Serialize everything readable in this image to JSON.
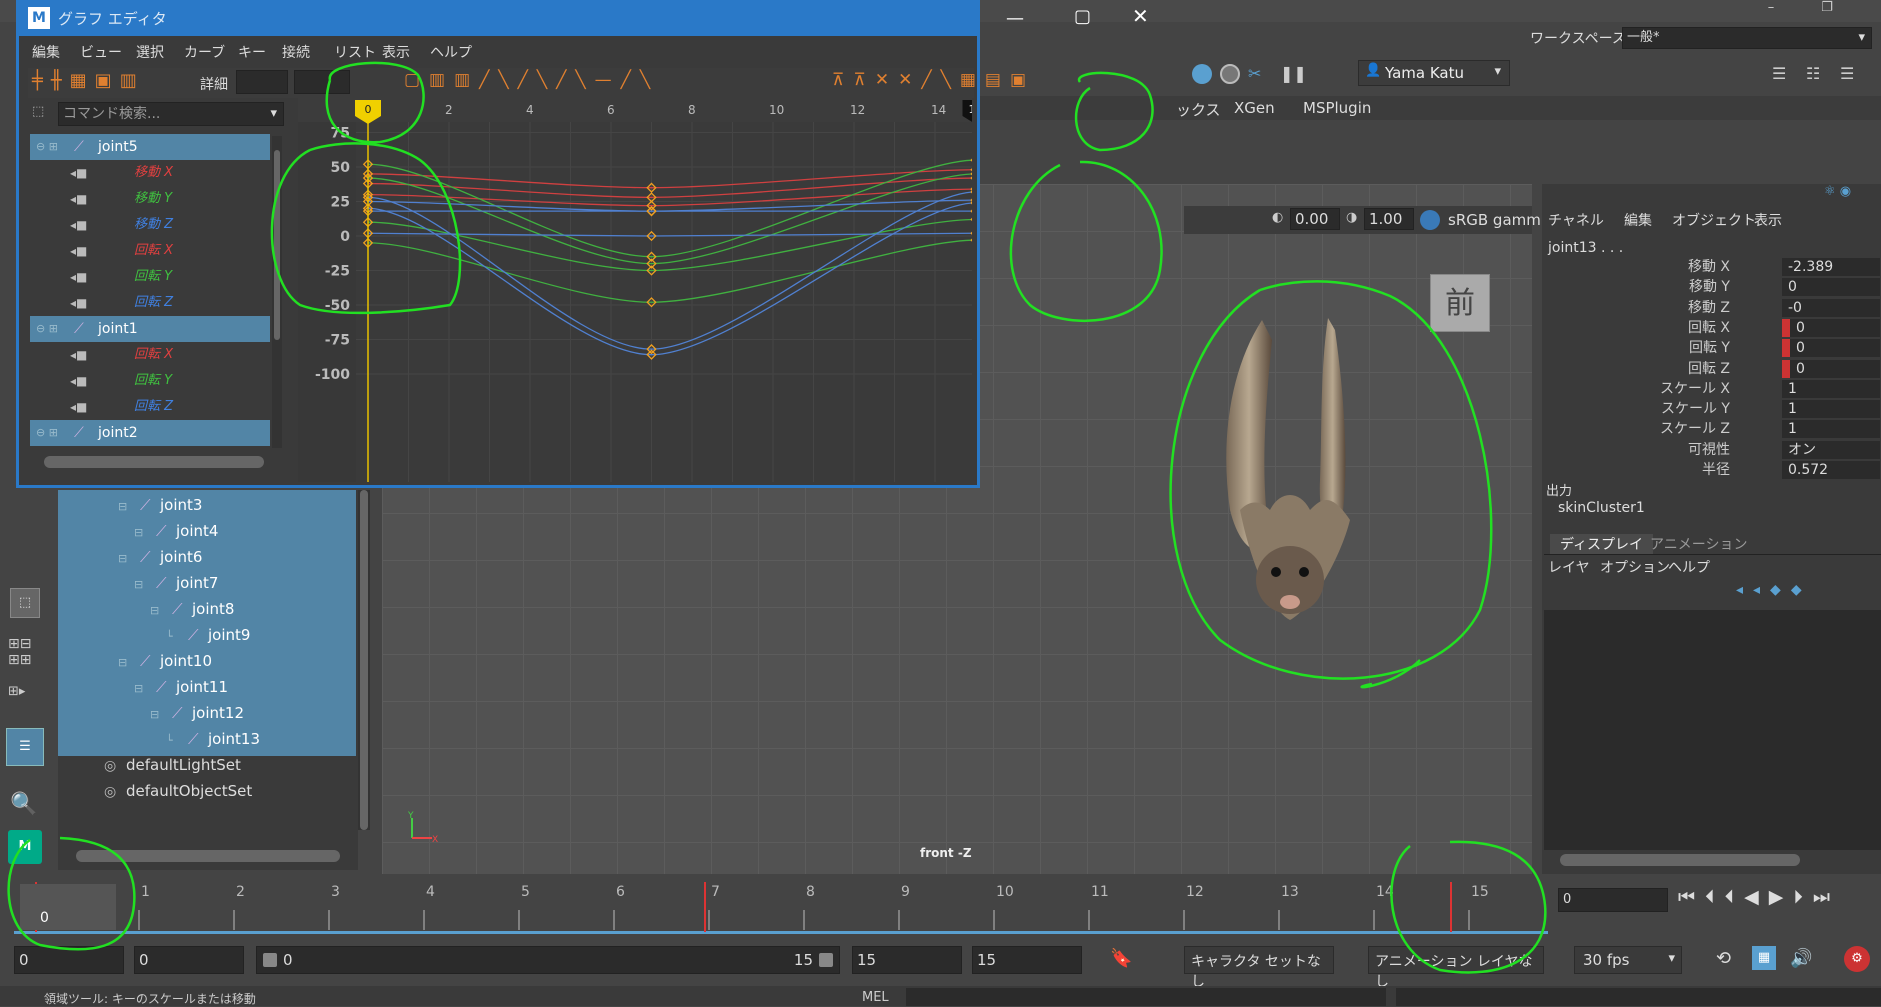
{
  "top_bar": {
    "workspace_label": "ワークスペース:",
    "workspace_value": "一般*",
    "user_name": "Yama Katu"
  },
  "shelf_tabs": [
    "ックス",
    "XGen",
    "MSPlugin"
  ],
  "graph_editor": {
    "title": "グラフ エディタ",
    "menu": [
      "編集",
      "ビュー",
      "選択",
      "カーブ",
      "キー",
      "接続",
      "リスト",
      "表示",
      "ヘルプ"
    ],
    "detail_label": "詳細",
    "search_placeholder": "コマンド検索...",
    "outliner": [
      {
        "type": "joint",
        "label": "joint5"
      },
      {
        "type": "attr",
        "label": "移動 X",
        "color": "#e04040"
      },
      {
        "type": "attr",
        "label": "移動 Y",
        "color": "#40c040"
      },
      {
        "type": "attr",
        "label": "移動 Z",
        "color": "#4080e0"
      },
      {
        "type": "attr",
        "label": "回転 X",
        "color": "#e04040"
      },
      {
        "type": "attr",
        "label": "回転 Y",
        "color": "#40c040"
      },
      {
        "type": "attr",
        "label": "回転 Z",
        "color": "#4080e0"
      },
      {
        "type": "joint",
        "label": "joint1"
      },
      {
        "type": "attr",
        "label": "回転 X",
        "color": "#e04040"
      },
      {
        "type": "attr",
        "label": "回転 Y",
        "color": "#40c040"
      },
      {
        "type": "attr",
        "label": "回転 Z",
        "color": "#4080e0"
      },
      {
        "type": "joint",
        "label": "joint2"
      }
    ],
    "x_ticks": [
      "2",
      "4",
      "6",
      "8",
      "10",
      "12",
      "14",
      "6"
    ],
    "y_ticks": [
      "75",
      "50",
      "25",
      "0",
      "-25",
      "-50",
      "-75",
      "-100"
    ],
    "current_frame": "0",
    "end_frame": "15"
  },
  "outliner": {
    "items": [
      {
        "label": "joint3",
        "indent": 0
      },
      {
        "label": "joint4",
        "indent": 1
      },
      {
        "label": "joint6",
        "indent": 0
      },
      {
        "label": "joint7",
        "indent": 1
      },
      {
        "label": "joint8",
        "indent": 2
      },
      {
        "label": "joint9",
        "indent": 3
      },
      {
        "label": "joint10",
        "indent": 0
      },
      {
        "label": "joint11",
        "indent": 1
      },
      {
        "label": "joint12",
        "indent": 2
      },
      {
        "label": "joint13",
        "indent": 3
      }
    ],
    "sets": [
      "defaultLightSet",
      "defaultObjectSet"
    ]
  },
  "viewport": {
    "exposure": "0.00",
    "gamma": "1.00",
    "color_space": "sRGB gamm",
    "view_label": "前",
    "camera_label": "front -Z"
  },
  "channel_box": {
    "menu": [
      "チャネル",
      "編集",
      "オブジェクト",
      "表示"
    ],
    "object_name": "joint13 . . .",
    "channels": [
      {
        "label": "移動 X",
        "value": "-2.389",
        "keyed": false
      },
      {
        "label": "移動 Y",
        "value": "0",
        "keyed": false
      },
      {
        "label": "移動 Z",
        "value": "-0",
        "keyed": false
      },
      {
        "label": "回転 X",
        "value": "0",
        "keyed": true
      },
      {
        "label": "回転 Y",
        "value": "0",
        "keyed": true
      },
      {
        "label": "回転 Z",
        "value": "0",
        "keyed": true
      },
      {
        "label": "スケール X",
        "value": "1",
        "keyed": false
      },
      {
        "label": "スケール Y",
        "value": "1",
        "keyed": false
      },
      {
        "label": "スケール Z",
        "value": "1",
        "keyed": false
      },
      {
        "label": "可視性",
        "value": "オン",
        "keyed": false
      },
      {
        "label": "半径",
        "value": "0.572",
        "keyed": false
      }
    ],
    "output_label": "出力",
    "output_value": "skinCluster1",
    "tabs": [
      "ディスプレイ",
      "アニメーション"
    ],
    "layer_menu": [
      "レイヤ",
      "オプション",
      "ヘルプ"
    ]
  },
  "timeline": {
    "ticks": [
      "0",
      "1",
      "2",
      "3",
      "4",
      "5",
      "6",
      "7",
      "8",
      "9",
      "10",
      "11",
      "12",
      "13",
      "14",
      "15"
    ],
    "current_frame": "0",
    "current_field": "0"
  },
  "range": {
    "start": "0",
    "anim_start": "0",
    "range_start": "0",
    "range_end": "15",
    "anim_end": "15",
    "end": "15",
    "character_set": "キャラクタ セットなし",
    "anim_layer": "アニメーション レイヤなし",
    "fps": "30 fps"
  },
  "status": {
    "help_text": "領域ツール: キーのスケールまたは移動",
    "mel_label": "MEL"
  },
  "colors": {
    "selection_blue": "#5285a6",
    "annotation_green": "#22e022",
    "curve_red": "#d04040",
    "curve_green": "#40b040",
    "curve_blue": "#5080d0",
    "key_orange": "#f0a020"
  }
}
